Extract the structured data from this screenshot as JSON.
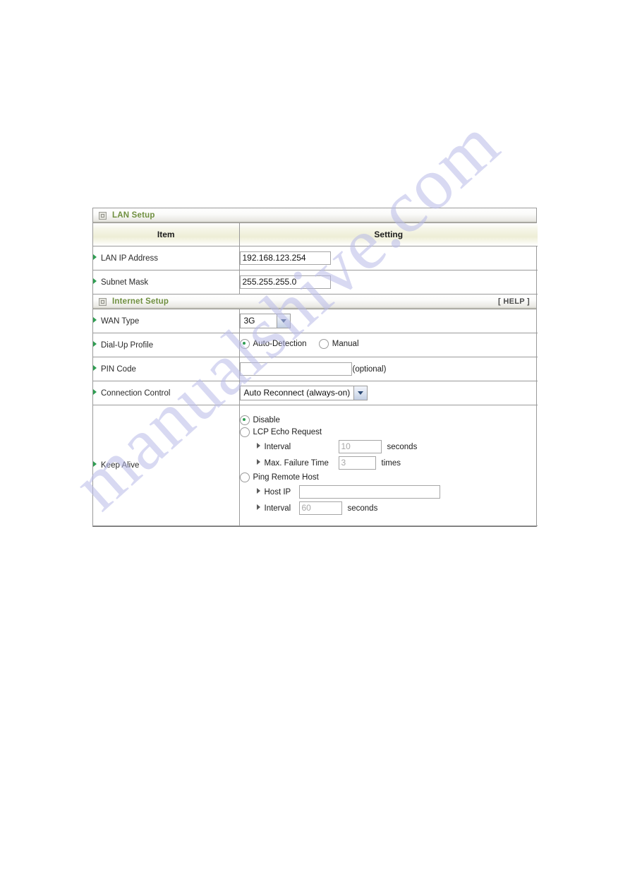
{
  "watermark": {
    "text": "manualshive.com"
  },
  "sections": {
    "lan": {
      "title": "LAN Setup",
      "icon": "window-box-icon",
      "headers": {
        "item": "Item",
        "setting": "Setting"
      },
      "rows": [
        {
          "label": "LAN IP Address",
          "value": "192.168.123.254"
        },
        {
          "label": "Subnet Mask",
          "value": "255.255.255.0"
        }
      ]
    },
    "internet": {
      "title": "Internet Setup",
      "icon": "window-box-icon",
      "help_label": "[ HELP ]",
      "rows": {
        "wan_type": {
          "label": "WAN Type",
          "selected": "3G"
        },
        "dial_up_profile": {
          "label": "Dial-Up Profile",
          "options": [
            {
              "label": "Auto-Detection",
              "selected": true
            },
            {
              "label": "Manual",
              "selected": false
            }
          ]
        },
        "pin_code": {
          "label": "PIN Code",
          "value": "",
          "note": "(optional)"
        },
        "connection_control": {
          "label": "Connection Control",
          "selected": "Auto Reconnect (always-on)"
        },
        "keep_alive": {
          "label": "Keep Alive",
          "options": [
            {
              "label": "Disable",
              "selected": true
            },
            {
              "label": "LCP Echo Request",
              "selected": false
            },
            {
              "label": "Ping Remote Host",
              "selected": false
            }
          ],
          "lcp_interval": {
            "label": "Interval",
            "value": "10",
            "unit": "seconds"
          },
          "lcp_max_failure": {
            "label": "Max. Failure Time",
            "value": "3",
            "unit": "times"
          },
          "ping_host_ip": {
            "label": "Host IP",
            "value": ""
          },
          "ping_interval": {
            "label": "Interval",
            "value": "60",
            "unit": "seconds"
          }
        }
      }
    }
  }
}
